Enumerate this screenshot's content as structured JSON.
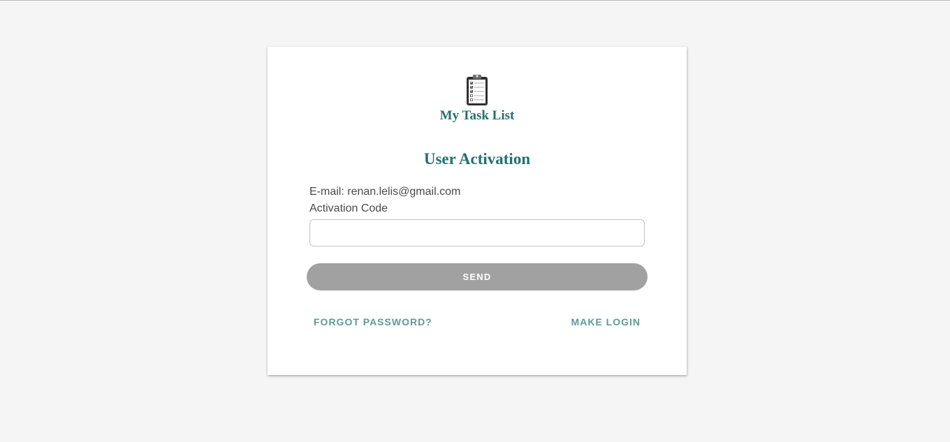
{
  "app": {
    "name": "My Task List",
    "logo_icon": "clipboard-checklist-icon"
  },
  "page": {
    "title": "User Activation"
  },
  "form": {
    "email_label": "E-mail:",
    "email_value": "renan.lelis@gmail.com",
    "activation_code_label": "Activation Code",
    "activation_code_value": "",
    "send_label": "SEND"
  },
  "links": {
    "forgot_password": "FORGOT PASSWORD?",
    "make_login": "MAKE LOGIN"
  },
  "colors": {
    "accent": "#25706e",
    "link": "#5e9a98",
    "button_disabled": "#a1a1a1",
    "background": "#f5f5f5"
  }
}
